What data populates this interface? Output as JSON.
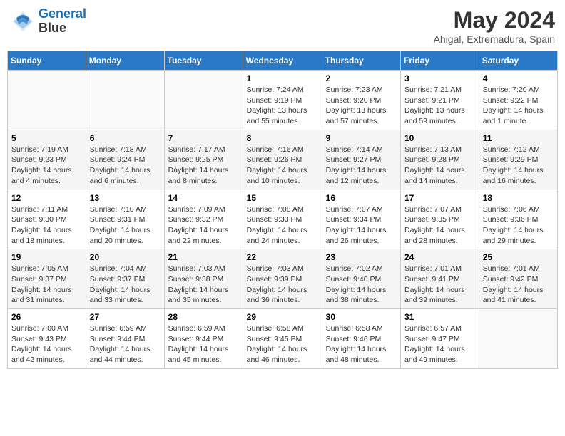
{
  "header": {
    "logo_line1": "General",
    "logo_line2": "Blue",
    "title": "May 2024",
    "location": "Ahigal, Extremadura, Spain"
  },
  "days_of_week": [
    "Sunday",
    "Monday",
    "Tuesday",
    "Wednesday",
    "Thursday",
    "Friday",
    "Saturday"
  ],
  "weeks": [
    [
      {
        "day": "",
        "sunrise": "",
        "sunset": "",
        "daylight": ""
      },
      {
        "day": "",
        "sunrise": "",
        "sunset": "",
        "daylight": ""
      },
      {
        "day": "",
        "sunrise": "",
        "sunset": "",
        "daylight": ""
      },
      {
        "day": "1",
        "sunrise": "Sunrise: 7:24 AM",
        "sunset": "Sunset: 9:19 PM",
        "daylight": "Daylight: 13 hours and 55 minutes."
      },
      {
        "day": "2",
        "sunrise": "Sunrise: 7:23 AM",
        "sunset": "Sunset: 9:20 PM",
        "daylight": "Daylight: 13 hours and 57 minutes."
      },
      {
        "day": "3",
        "sunrise": "Sunrise: 7:21 AM",
        "sunset": "Sunset: 9:21 PM",
        "daylight": "Daylight: 13 hours and 59 minutes."
      },
      {
        "day": "4",
        "sunrise": "Sunrise: 7:20 AM",
        "sunset": "Sunset: 9:22 PM",
        "daylight": "Daylight: 14 hours and 1 minute."
      }
    ],
    [
      {
        "day": "5",
        "sunrise": "Sunrise: 7:19 AM",
        "sunset": "Sunset: 9:23 PM",
        "daylight": "Daylight: 14 hours and 4 minutes."
      },
      {
        "day": "6",
        "sunrise": "Sunrise: 7:18 AM",
        "sunset": "Sunset: 9:24 PM",
        "daylight": "Daylight: 14 hours and 6 minutes."
      },
      {
        "day": "7",
        "sunrise": "Sunrise: 7:17 AM",
        "sunset": "Sunset: 9:25 PM",
        "daylight": "Daylight: 14 hours and 8 minutes."
      },
      {
        "day": "8",
        "sunrise": "Sunrise: 7:16 AM",
        "sunset": "Sunset: 9:26 PM",
        "daylight": "Daylight: 14 hours and 10 minutes."
      },
      {
        "day": "9",
        "sunrise": "Sunrise: 7:14 AM",
        "sunset": "Sunset: 9:27 PM",
        "daylight": "Daylight: 14 hours and 12 minutes."
      },
      {
        "day": "10",
        "sunrise": "Sunrise: 7:13 AM",
        "sunset": "Sunset: 9:28 PM",
        "daylight": "Daylight: 14 hours and 14 minutes."
      },
      {
        "day": "11",
        "sunrise": "Sunrise: 7:12 AM",
        "sunset": "Sunset: 9:29 PM",
        "daylight": "Daylight: 14 hours and 16 minutes."
      }
    ],
    [
      {
        "day": "12",
        "sunrise": "Sunrise: 7:11 AM",
        "sunset": "Sunset: 9:30 PM",
        "daylight": "Daylight: 14 hours and 18 minutes."
      },
      {
        "day": "13",
        "sunrise": "Sunrise: 7:10 AM",
        "sunset": "Sunset: 9:31 PM",
        "daylight": "Daylight: 14 hours and 20 minutes."
      },
      {
        "day": "14",
        "sunrise": "Sunrise: 7:09 AM",
        "sunset": "Sunset: 9:32 PM",
        "daylight": "Daylight: 14 hours and 22 minutes."
      },
      {
        "day": "15",
        "sunrise": "Sunrise: 7:08 AM",
        "sunset": "Sunset: 9:33 PM",
        "daylight": "Daylight: 14 hours and 24 minutes."
      },
      {
        "day": "16",
        "sunrise": "Sunrise: 7:07 AM",
        "sunset": "Sunset: 9:34 PM",
        "daylight": "Daylight: 14 hours and 26 minutes."
      },
      {
        "day": "17",
        "sunrise": "Sunrise: 7:07 AM",
        "sunset": "Sunset: 9:35 PM",
        "daylight": "Daylight: 14 hours and 28 minutes."
      },
      {
        "day": "18",
        "sunrise": "Sunrise: 7:06 AM",
        "sunset": "Sunset: 9:36 PM",
        "daylight": "Daylight: 14 hours and 29 minutes."
      }
    ],
    [
      {
        "day": "19",
        "sunrise": "Sunrise: 7:05 AM",
        "sunset": "Sunset: 9:37 PM",
        "daylight": "Daylight: 14 hours and 31 minutes."
      },
      {
        "day": "20",
        "sunrise": "Sunrise: 7:04 AM",
        "sunset": "Sunset: 9:37 PM",
        "daylight": "Daylight: 14 hours and 33 minutes."
      },
      {
        "day": "21",
        "sunrise": "Sunrise: 7:03 AM",
        "sunset": "Sunset: 9:38 PM",
        "daylight": "Daylight: 14 hours and 35 minutes."
      },
      {
        "day": "22",
        "sunrise": "Sunrise: 7:03 AM",
        "sunset": "Sunset: 9:39 PM",
        "daylight": "Daylight: 14 hours and 36 minutes."
      },
      {
        "day": "23",
        "sunrise": "Sunrise: 7:02 AM",
        "sunset": "Sunset: 9:40 PM",
        "daylight": "Daylight: 14 hours and 38 minutes."
      },
      {
        "day": "24",
        "sunrise": "Sunrise: 7:01 AM",
        "sunset": "Sunset: 9:41 PM",
        "daylight": "Daylight: 14 hours and 39 minutes."
      },
      {
        "day": "25",
        "sunrise": "Sunrise: 7:01 AM",
        "sunset": "Sunset: 9:42 PM",
        "daylight": "Daylight: 14 hours and 41 minutes."
      }
    ],
    [
      {
        "day": "26",
        "sunrise": "Sunrise: 7:00 AM",
        "sunset": "Sunset: 9:43 PM",
        "daylight": "Daylight: 14 hours and 42 minutes."
      },
      {
        "day": "27",
        "sunrise": "Sunrise: 6:59 AM",
        "sunset": "Sunset: 9:44 PM",
        "daylight": "Daylight: 14 hours and 44 minutes."
      },
      {
        "day": "28",
        "sunrise": "Sunrise: 6:59 AM",
        "sunset": "Sunset: 9:44 PM",
        "daylight": "Daylight: 14 hours and 45 minutes."
      },
      {
        "day": "29",
        "sunrise": "Sunrise: 6:58 AM",
        "sunset": "Sunset: 9:45 PM",
        "daylight": "Daylight: 14 hours and 46 minutes."
      },
      {
        "day": "30",
        "sunrise": "Sunrise: 6:58 AM",
        "sunset": "Sunset: 9:46 PM",
        "daylight": "Daylight: 14 hours and 48 minutes."
      },
      {
        "day": "31",
        "sunrise": "Sunrise: 6:57 AM",
        "sunset": "Sunset: 9:47 PM",
        "daylight": "Daylight: 14 hours and 49 minutes."
      },
      {
        "day": "",
        "sunrise": "",
        "sunset": "",
        "daylight": ""
      }
    ]
  ]
}
